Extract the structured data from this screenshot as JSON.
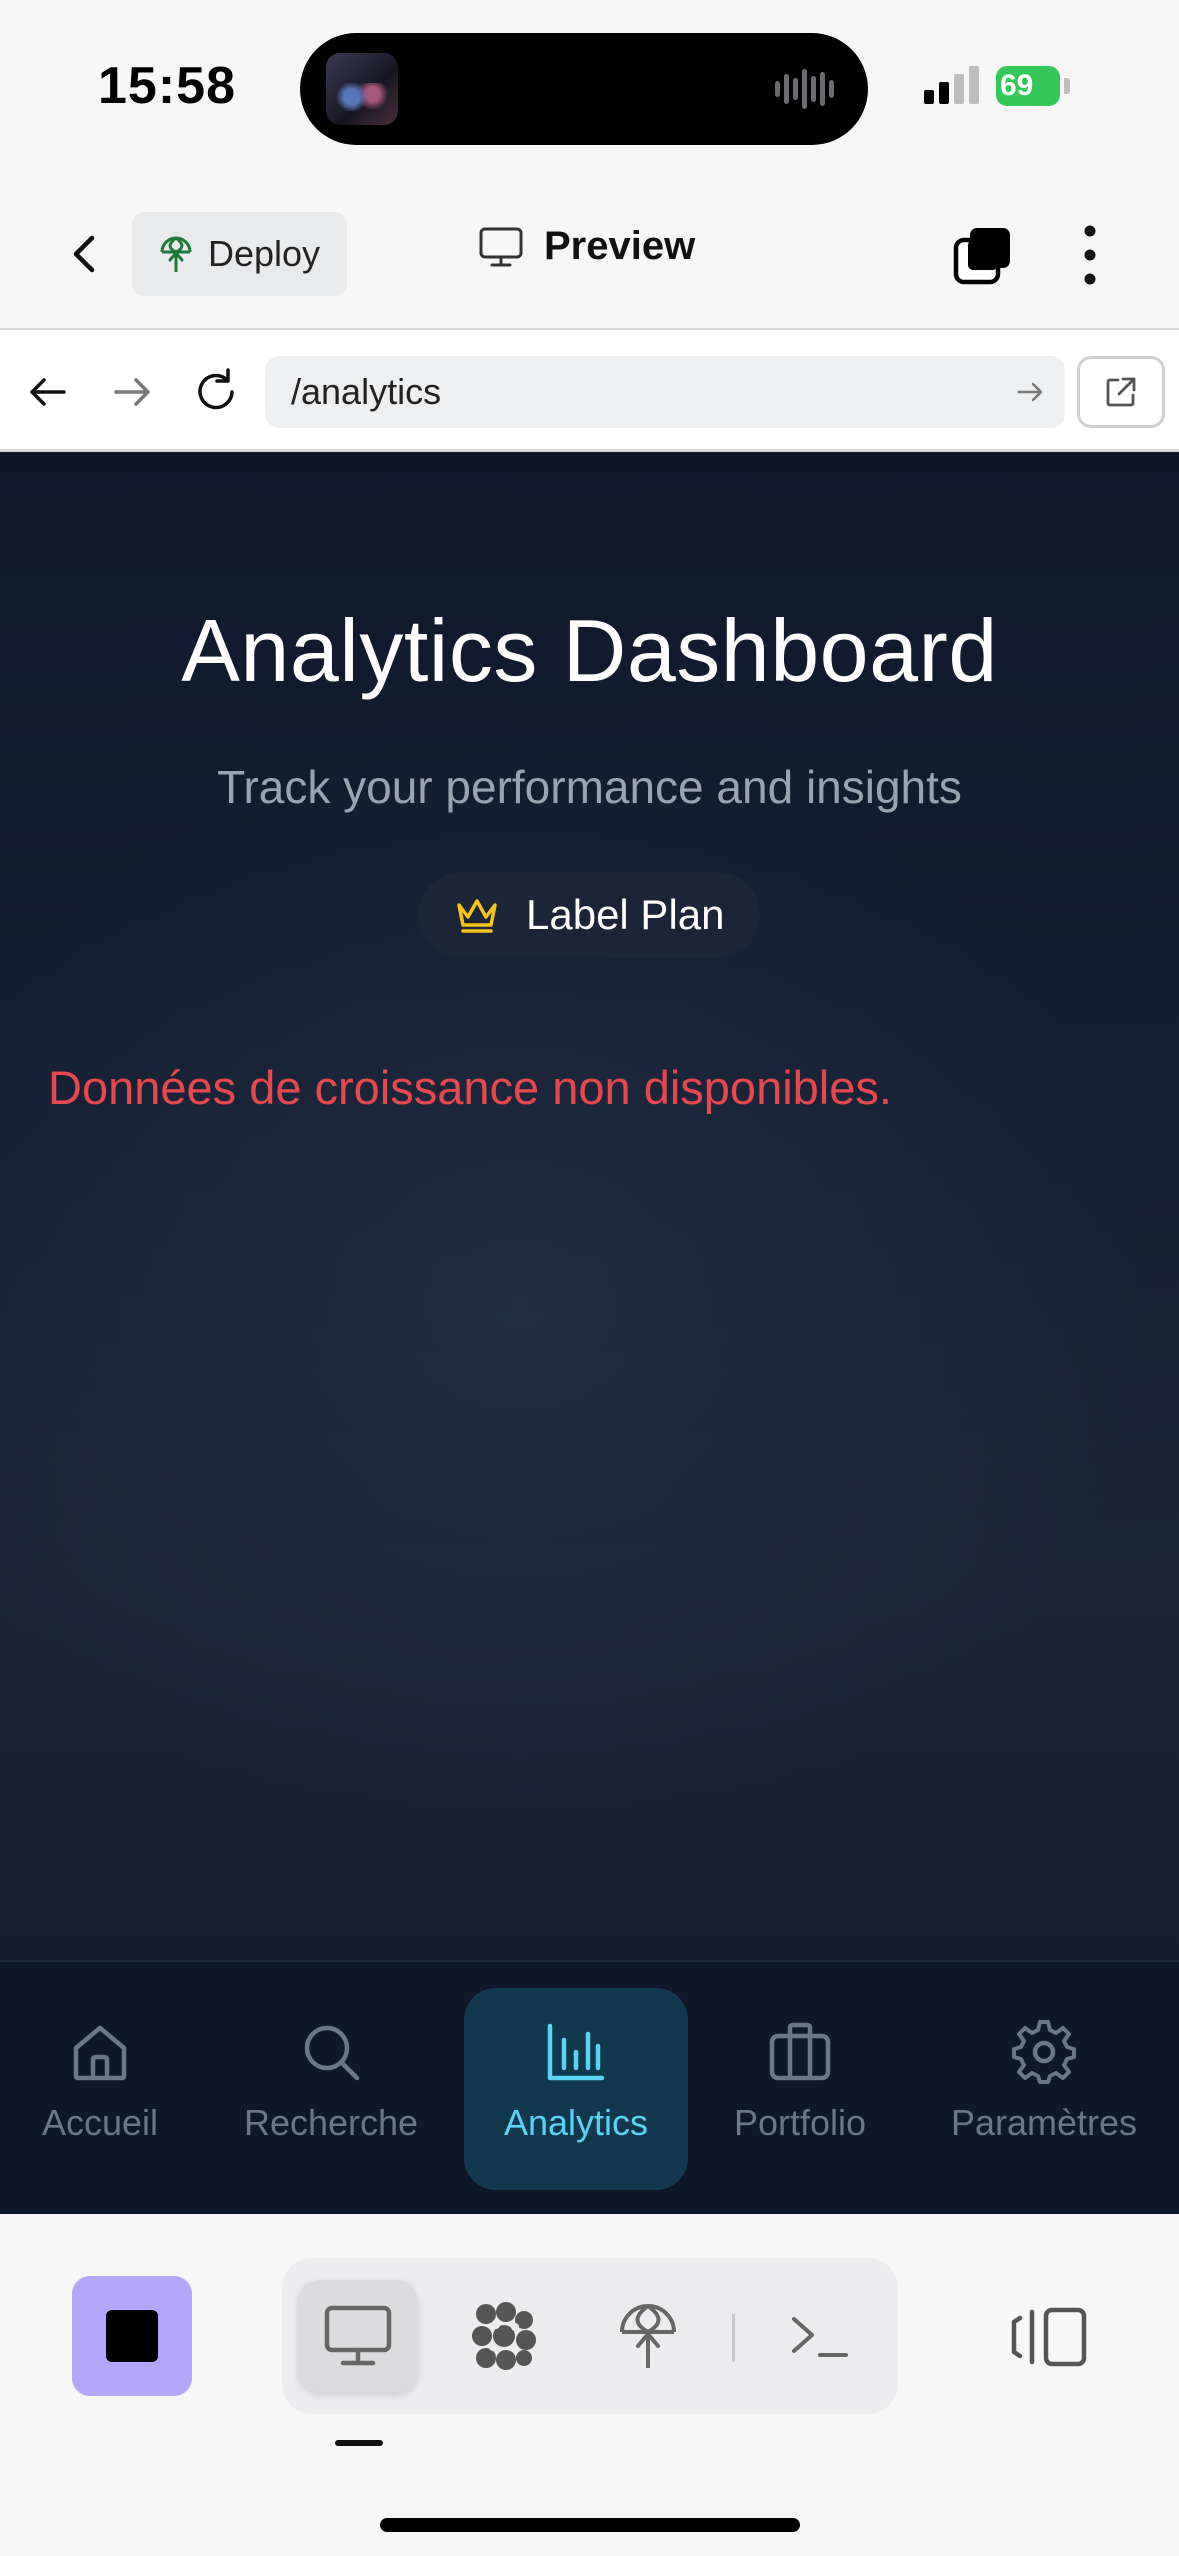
{
  "status_bar": {
    "time": "15:58",
    "battery_level": "69",
    "signal_bars": 2,
    "icons": [
      "signal-icon",
      "battery-charging-icon"
    ]
  },
  "app_header": {
    "back_icon": "chevron-left-icon",
    "deploy_label": "Deploy",
    "deploy_icon": "globe-antenna-icon",
    "preview_label": "Preview",
    "preview_icon": "monitor-icon",
    "windows_icon": "stacked-windows-icon",
    "more_icon": "vertical-dots-icon"
  },
  "browser": {
    "url": "/analytics",
    "icons": [
      "arrow-left-icon",
      "arrow-right-icon",
      "reload-icon",
      "arrow-go-icon",
      "external-link-icon"
    ]
  },
  "main": {
    "title": "Analytics Dashboard",
    "subtitle": "Track your performance and insights",
    "plan_badge": "Label Plan",
    "plan_icon": "crown-icon",
    "error_message": "Données de croissance non disponibles.",
    "colors": {
      "background": "#151f33",
      "error": "#e5484d",
      "crown": "#f5c518"
    }
  },
  "tab_bar": {
    "tabs": [
      {
        "label": "Accueil",
        "icon": "home-icon",
        "active": false
      },
      {
        "label": "Recherche",
        "icon": "search-icon",
        "active": false
      },
      {
        "label": "Analytics",
        "icon": "bar-chart-icon",
        "active": true
      },
      {
        "label": "Portfolio",
        "icon": "briefcase-icon",
        "active": false
      },
      {
        "label": "Paramètres",
        "icon": "gear-icon",
        "active": false
      }
    ],
    "colors": {
      "active": "#5ad3f5",
      "inactive": "#6b7689"
    }
  },
  "toolbar": {
    "stop_icon": "stop-icon",
    "tools": [
      "monitor-icon",
      "hub-icon",
      "globe-antenna-icon",
      "terminal-icon"
    ],
    "active_tool": "monitor-icon",
    "panel_icon": "split-panel-icon",
    "accent_color": "#b3a6fb"
  }
}
